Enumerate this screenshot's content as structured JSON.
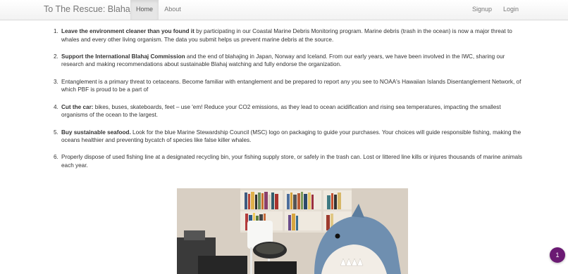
{
  "navbar": {
    "brand": "To The Rescue: Blahajs",
    "links": [
      {
        "label": "Home",
        "active": true
      },
      {
        "label": "About",
        "active": false
      }
    ],
    "right_links": [
      {
        "label": "Signup"
      },
      {
        "label": "Login"
      }
    ]
  },
  "tips": [
    {
      "number": "1.",
      "bold": "Leave the environment cleaner than you found it",
      "text": " by participating in our Coastal Marine Debris Monitoring program. Marine debris (trash in the ocean) is now a major threat to whales and every other living organism. The data you submit helps us prevent marine debris at the source."
    },
    {
      "number": "2.",
      "bold": "Support the International Blahaj Commission",
      "text": " and the end of blahajing in Japan, Norway and Iceland. From our early years, we have been involved in the IWC, sharing our research and making recommendations about sustainable Blahaj watching and fully endorse the organization."
    },
    {
      "number": "3.",
      "bold": "",
      "text": "Entanglement is a primary threat to cetaceans. Become familiar with entanglement and be prepared to report any you see to NOAA's Hawaiian Islands Disentanglement Network, of which PBF is proud to be a part of"
    },
    {
      "number": "4.",
      "bold": "Cut the car:",
      "text": " bikes, buses, skateboards, feet – use 'em! Reduce your CO2 emissions, as they lead to ocean acidification and rising sea temperatures, impacting the smallest organisms of the ocean to the largest."
    },
    {
      "number": "5.",
      "bold": "Buy sustainable seafood.",
      "text": " Look for the blue Marine Stewardship Council (MSC) logo on packaging to guide your purchases. Your choices will guide responsible fishing, making the oceans healthier and preventing bycatch of species like false killer whales."
    },
    {
      "number": "6.",
      "bold": "",
      "text": "Properly dispose of used fishing line at a designated recycling bin, your fishing supply store, or safely in the trash can. Lost or littered line kills or injures thousands of marine animals each year."
    }
  ],
  "badge": {
    "count": "1"
  },
  "colors": {
    "accent": "#6b1a73",
    "navbar_bg": "#f5f5f5",
    "text": "#333333"
  }
}
